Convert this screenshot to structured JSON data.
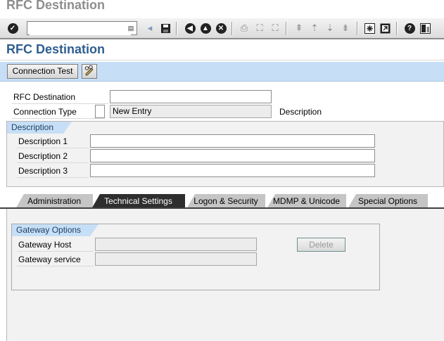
{
  "window": {
    "title": "RFC Destination"
  },
  "toolbar": {
    "command_field": {
      "value": "",
      "placeholder": ""
    },
    "icons": [
      "enter-icon",
      "save-icon",
      "back-icon",
      "exit-icon",
      "cancel-icon",
      "print-icon",
      "find-icon",
      "find-next-icon",
      "first-page-icon",
      "previous-page-icon",
      "next-page-icon",
      "last-page-icon",
      "create-session-icon",
      "shortcut-icon",
      "help-icon",
      "customize-layout-icon"
    ]
  },
  "page": {
    "title": "RFC Destination"
  },
  "app_toolbar": {
    "connection_test_label": "Connection Test"
  },
  "header": {
    "rfc_destination_label": "RFC Destination",
    "rfc_destination_value": "",
    "connection_type_label": "Connection Type",
    "connection_type_code": "",
    "connection_type_text": "New Entry",
    "description_label": "Description"
  },
  "description_group": {
    "title": "Description",
    "fields": [
      {
        "label": "Description 1",
        "value": ""
      },
      {
        "label": "Description 2",
        "value": ""
      },
      {
        "label": "Description 3",
        "value": ""
      }
    ]
  },
  "tabs": [
    {
      "label": "Administration",
      "active": false
    },
    {
      "label": "Technical Settings",
      "active": true
    },
    {
      "label": "Logon & Security",
      "active": false
    },
    {
      "label": "MDMP & Unicode",
      "active": false
    },
    {
      "label": "Special Options",
      "active": false
    }
  ],
  "gateway_group": {
    "title": "Gateway Options",
    "gateway_host_label": "Gateway Host",
    "gateway_host_value": "",
    "gateway_service_label": "Gateway service",
    "gateway_service_value": "",
    "delete_label": "Delete"
  },
  "colors": {
    "accent_title": "#2f5e8f",
    "app_toolbar_bg": "#c6dff6",
    "active_tab_bg": "#2e2e2e",
    "inactive_tab_bg": "#c5c5c5"
  }
}
